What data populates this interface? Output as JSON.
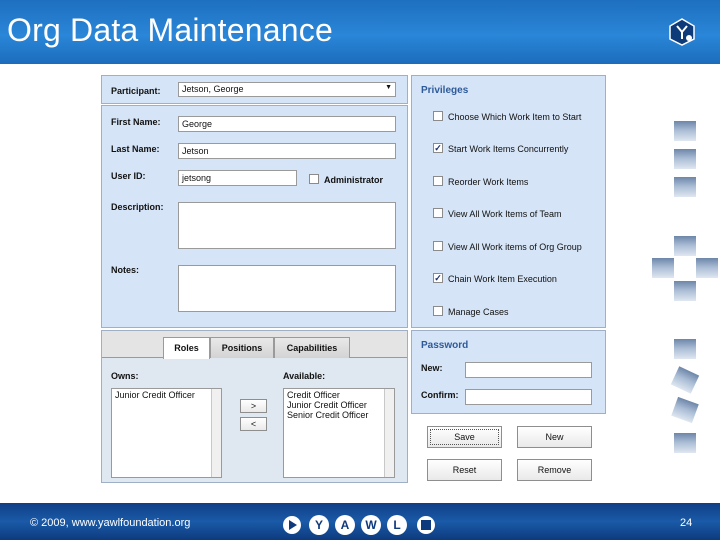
{
  "slide": {
    "title": "Org Data Maintenance",
    "footer_copyright": "© 2009, www.yawlfoundation.org",
    "page_number": "24",
    "logo_letters": [
      "Y",
      "A",
      "W",
      "L"
    ]
  },
  "colors": {
    "header_blue": "#2a86d8",
    "footer_blue": "#1a5aa8",
    "panel_bg": "#d5e4f6",
    "section_heading": "#2e5a9a"
  },
  "form": {
    "participant_label": "Participant:",
    "participant_value": "Jetson, George",
    "first_name_label": "First Name:",
    "first_name_value": "George",
    "last_name_label": "Last Name:",
    "last_name_value": "Jetson",
    "user_id_label": "User ID:",
    "user_id_value": "jetsong",
    "administrator_label": "Administrator",
    "administrator_checked": false,
    "description_label": "Description:",
    "notes_label": "Notes:"
  },
  "privileges": {
    "heading": "Privileges",
    "items": [
      {
        "label": "Choose Which Work Item to Start",
        "checked": false
      },
      {
        "label": "Start Work Items Concurrently",
        "checked": true
      },
      {
        "label": "Reorder Work Items",
        "checked": false
      },
      {
        "label": "View All Work Items of Team",
        "checked": false
      },
      {
        "label": "View All Work items of Org Group",
        "checked": false
      },
      {
        "label": "Chain Work Item Execution",
        "checked": true
      },
      {
        "label": "Manage Cases",
        "checked": false
      }
    ]
  },
  "tabs": {
    "roles": "Roles",
    "positions": "Positions",
    "capabilities": "Capabilities",
    "active": "roles"
  },
  "roles": {
    "owns_label": "Owns:",
    "available_label": "Available:",
    "owns": [
      "Junior Credit Officer"
    ],
    "available": [
      "Credit Officer",
      "Junior Credit Officer",
      "Senior Credit Officer"
    ],
    "add_label": ">",
    "remove_label": "<"
  },
  "password": {
    "heading": "Password",
    "new_label": "New:",
    "confirm_label": "Confirm:"
  },
  "actions": {
    "save": "Save",
    "new": "New",
    "reset": "Reset",
    "remove": "Remove"
  }
}
